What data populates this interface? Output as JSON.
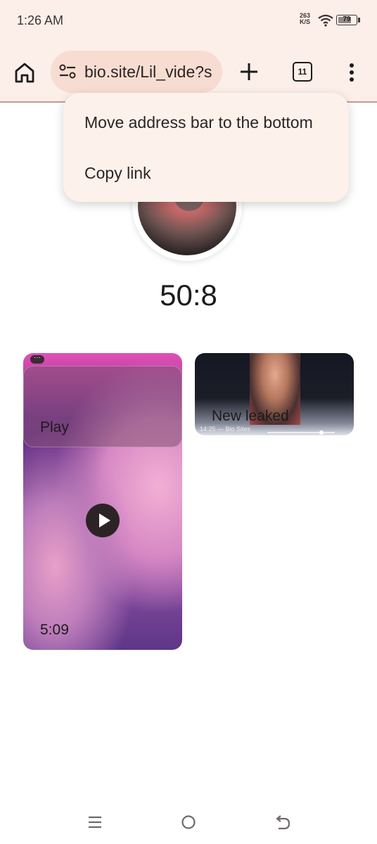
{
  "status_bar": {
    "time": "1:26 AM",
    "net_speed_value": "263",
    "net_speed_unit": "K/S",
    "battery_level": "79",
    "battery_fraction": 0.79
  },
  "toolbar": {
    "url": "bio.site/Lil_vide?s",
    "tab_count": "11"
  },
  "menu": {
    "items": [
      {
        "label": "Move address bar to the bottom"
      },
      {
        "label": "Copy link"
      }
    ]
  },
  "profile": {
    "counter": "50:8"
  },
  "cards": {
    "left": {
      "title": "Play",
      "duration": "5:09",
      "dots": "···"
    },
    "right": {
      "title": "New leaked",
      "meta": "14:25 — Bio Sites"
    }
  },
  "colors": {
    "chrome_bg": "#fcefe9",
    "omnibox_bg": "#f7dcd2",
    "menu_bg": "#fdf1ec",
    "divider": "#c59a90"
  },
  "icons": {
    "home": "home-icon",
    "site_settings": "tune-icon",
    "new_tab": "plus-icon",
    "tabs": "tab-switcher-icon",
    "more": "more-vert-icon",
    "play": "play-icon",
    "nav_recents": "menu-icon",
    "nav_home": "circle-icon",
    "nav_back": "back-icon"
  }
}
